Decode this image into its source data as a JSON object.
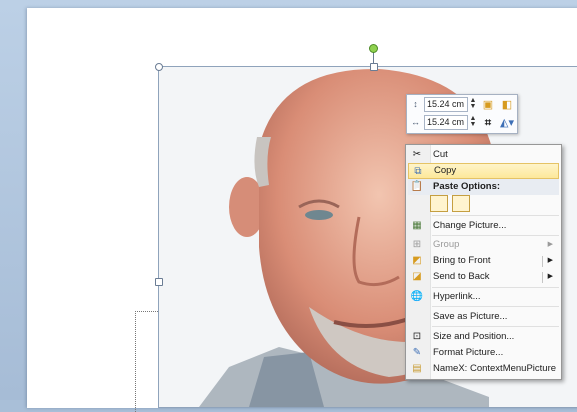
{
  "mini_toolbar": {
    "height_value": "15.24 cm",
    "width_value": "15.24 cm",
    "icons": [
      "shape-height-icon",
      "bring-forward-icon",
      "send-backward-icon",
      "shape-width-icon",
      "crop-icon",
      "picture-effects-icon"
    ]
  },
  "context_menu": {
    "items": [
      {
        "label": "Cut",
        "icon": "scissors-icon"
      },
      {
        "label": "Copy",
        "icon": "copy-icon",
        "highlighted": true
      },
      {
        "label": "Paste Options:",
        "icon": "paste-icon",
        "header": true
      },
      {
        "label": "Change Picture...",
        "icon": "change-picture-icon"
      },
      {
        "label": "Group",
        "icon": "group-icon",
        "disabled": true,
        "submenu": true
      },
      {
        "label": "Bring to Front",
        "icon": "bring-to-front-icon",
        "submenu": true
      },
      {
        "label": "Send to Back",
        "icon": "send-to-back-icon",
        "submenu": true
      },
      {
        "label": "Hyperlink...",
        "icon": "globe-link-icon"
      },
      {
        "label": "Save as Picture...",
        "icon": ""
      },
      {
        "label": "Size and Position...",
        "icon": "size-position-icon"
      },
      {
        "label": "Format Picture...",
        "icon": "format-picture-icon"
      },
      {
        "label": "NameX: ContextMenuPicture",
        "icon": "namex-icon"
      }
    ],
    "paste_options": [
      "paste-picture-icon",
      "keep-text-only-icon"
    ]
  },
  "colors": {
    "menu_highlight": "#fde89a",
    "workspace": "#a9bfd8",
    "rotation_handle": "#8fd14f"
  }
}
